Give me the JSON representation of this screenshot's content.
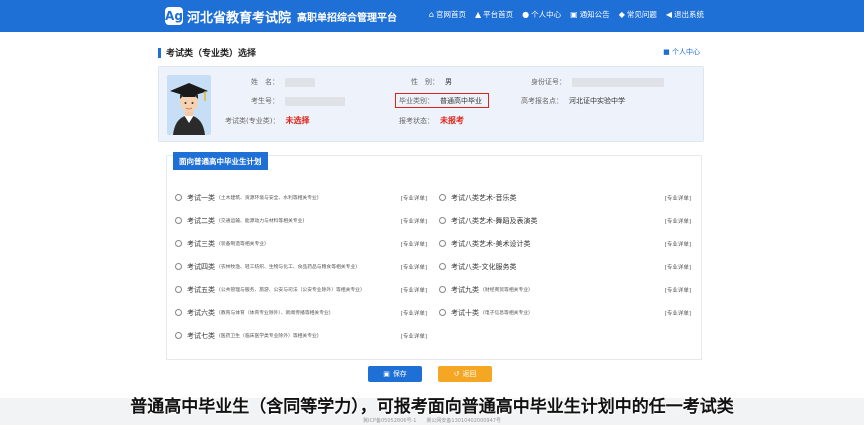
{
  "header": {
    "logo_mark": "Ag",
    "title": "河北省教育考试院",
    "subtitle": "高职单招综合管理平台",
    "nav": [
      {
        "icon": "home-icon",
        "glyph": "⌂",
        "label": "官网首页"
      },
      {
        "icon": "platform-icon",
        "glyph": "▲",
        "label": "平台首页"
      },
      {
        "icon": "user-icon",
        "glyph": "●",
        "label": "个人中心"
      },
      {
        "icon": "notice-icon",
        "glyph": "▣",
        "label": "通知公告"
      },
      {
        "icon": "faq-icon",
        "glyph": "◆",
        "label": "常见问题"
      },
      {
        "icon": "logout-icon",
        "glyph": "◀",
        "label": "退出系统"
      }
    ]
  },
  "page": {
    "title": "考试类（专业类）选择",
    "personal_center": "个人中心"
  },
  "info": {
    "name_label": "姓　名：",
    "gender_label": "性　别：",
    "gender_value": "男",
    "id_label": "身份证号：",
    "exam_no_label": "考生号：",
    "grad_type_label": "毕业类别：",
    "grad_type_value": "普通高中毕业",
    "site_label": "高考报名点：",
    "site_value": "河北证中实验中学",
    "exam_type_label": "考试类(专业类)：",
    "exam_type_value": "未选择",
    "status_label": "报考状态：",
    "status_value": "未报考"
  },
  "plans": {
    "tab": "面向普通高中毕业生计划",
    "detail_label": "[专业详单]",
    "left": [
      {
        "name": "考试一类",
        "note": "(土木建筑、资源环境与安全、水利等相关专业)"
      },
      {
        "name": "考试二类",
        "note": "(交通运输、能源动力与材料等相关专业)"
      },
      {
        "name": "考试三类",
        "note": "(装备制造等相关专业)"
      },
      {
        "name": "考试四类",
        "note": "(农林牧渔、轻工纺织、生物与化工、食品药品与粮食等相关专业)"
      },
      {
        "name": "考试五类",
        "note": "(公共管理与服务、旅游、公安与司法（公安专业除外）等相关专业)"
      },
      {
        "name": "考试六类",
        "note": "(教育与体育（体育专业除外）、新闻传播等相关专业)"
      },
      {
        "name": "考试七类",
        "note": "(医药卫生（临床医学类专业除外）等相关专业)"
      }
    ],
    "right": [
      {
        "name": "考试八类艺术-音乐类",
        "note": ""
      },
      {
        "name": "考试八类艺术-舞蹈及表演类",
        "note": ""
      },
      {
        "name": "考试八类艺术-美术设计类",
        "note": ""
      },
      {
        "name": "考试八类-文化服务类",
        "note": ""
      },
      {
        "name": "考试九类",
        "note": "(财经商贸等相关专业)"
      },
      {
        "name": "考试十类",
        "note": "(电子信息等相关专业)"
      }
    ]
  },
  "buttons": {
    "save": "保存",
    "back": "返回"
  },
  "footer": {
    "icp": "冀ICP备05052806号-1　　冀公网安备13010402000947号"
  },
  "caption": "普通高中毕业生（含同等学力），可报考面向普通高中毕业生计划中的任一考试类"
}
